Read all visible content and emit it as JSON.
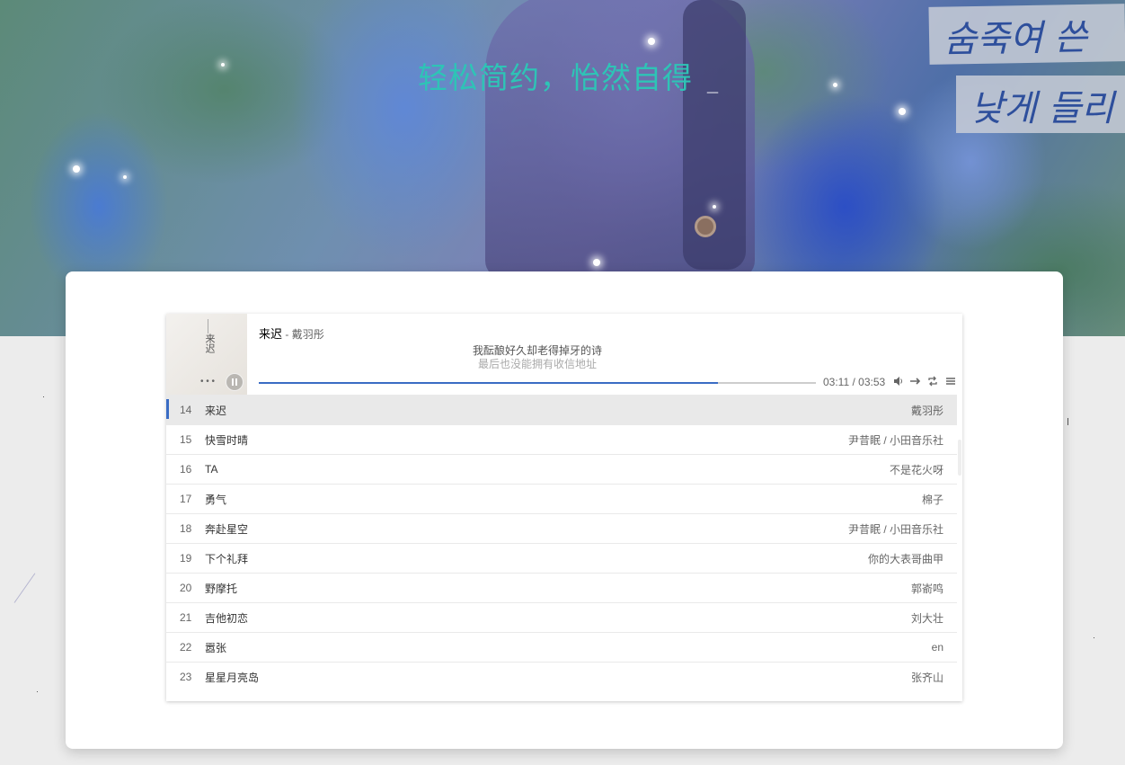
{
  "banner": {
    "slogan": "轻松简约，怡然自得",
    "cursor": "_",
    "hangul_line1": "숨죽여 쓴",
    "hangul_line2": "낮게 들리"
  },
  "player": {
    "cover_text": "来迟",
    "cover_dots": "• • •",
    "title": "来迟",
    "separator": " - ",
    "artist": "戴羽彤",
    "lyric_current": "我酝酿好久却老得掉牙的诗",
    "lyric_next": "最后也没能拥有收信地址",
    "progress": 0.824,
    "time": "03:11 / 03:53",
    "accent_color": "#3a6cc4",
    "controls": [
      "volume-icon",
      "order-icon",
      "loop-icon",
      "menu-icon"
    ]
  },
  "playlist": [
    {
      "idx": "14",
      "name": "来迟",
      "singer": "戴羽彤",
      "active": true
    },
    {
      "idx": "15",
      "name": "快雪时晴",
      "singer": "尹昔眠 / 小田音乐社"
    },
    {
      "idx": "16",
      "name": "TA",
      "singer": "不是花火呀"
    },
    {
      "idx": "17",
      "name": "勇气",
      "singer": "棉子"
    },
    {
      "idx": "18",
      "name": "奔赴星空",
      "singer": "尹昔眠 / 小田音乐社"
    },
    {
      "idx": "19",
      "name": "下个礼拜",
      "singer": "你的大表哥曲甲"
    },
    {
      "idx": "20",
      "name": "野摩托",
      "singer": "郭嵛鸣"
    },
    {
      "idx": "21",
      "name": "吉他初恋",
      "singer": "刘大壮"
    },
    {
      "idx": "22",
      "name": "嚣张",
      "singer": "en"
    },
    {
      "idx": "23",
      "name": "星星月亮岛",
      "singer": "张齐山"
    }
  ]
}
